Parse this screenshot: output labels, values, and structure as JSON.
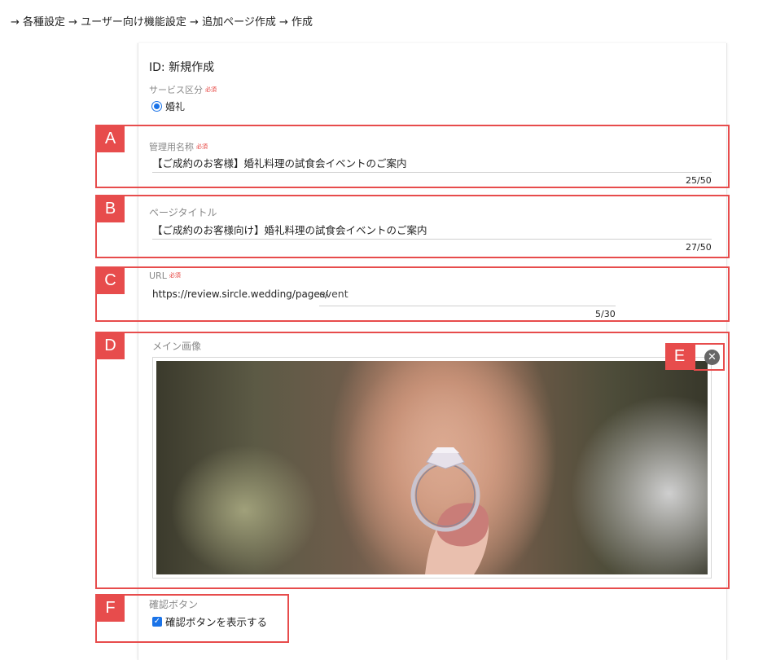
{
  "breadcrumb": "→ 各種設定 → ユーザー向け機能設定 → 追加ページ作成 → 作成",
  "form": {
    "id_title": "ID: 新規作成",
    "required_mark": "必須",
    "service_category": {
      "label": "サービス区分",
      "selected": "婚礼"
    },
    "admin_name": {
      "label": "管理用名称",
      "value": "【ご成約のお客様】婚礼料理の試食会イベントのご案内",
      "counter": "25/50"
    },
    "page_title": {
      "label": "ページタイトル",
      "value": "【ご成約のお客様向け】婚礼料理の試食会イベントのご案内",
      "counter": "27/50"
    },
    "url": {
      "label": "URL",
      "prefix": "https://review.sircle.wedding/pages/",
      "value": "event",
      "counter": "5/30"
    },
    "main_image": {
      "label": "メイン画像",
      "close_icon": "close-circle-icon"
    },
    "confirm_button": {
      "label": "確認ボタン",
      "checkbox_label": "確認ボタンを表示する",
      "checked": true
    }
  },
  "callouts": [
    "A",
    "B",
    "C",
    "D",
    "E",
    "F"
  ],
  "colors": {
    "callout": "#e74c4c",
    "accent": "#1a73e8"
  }
}
